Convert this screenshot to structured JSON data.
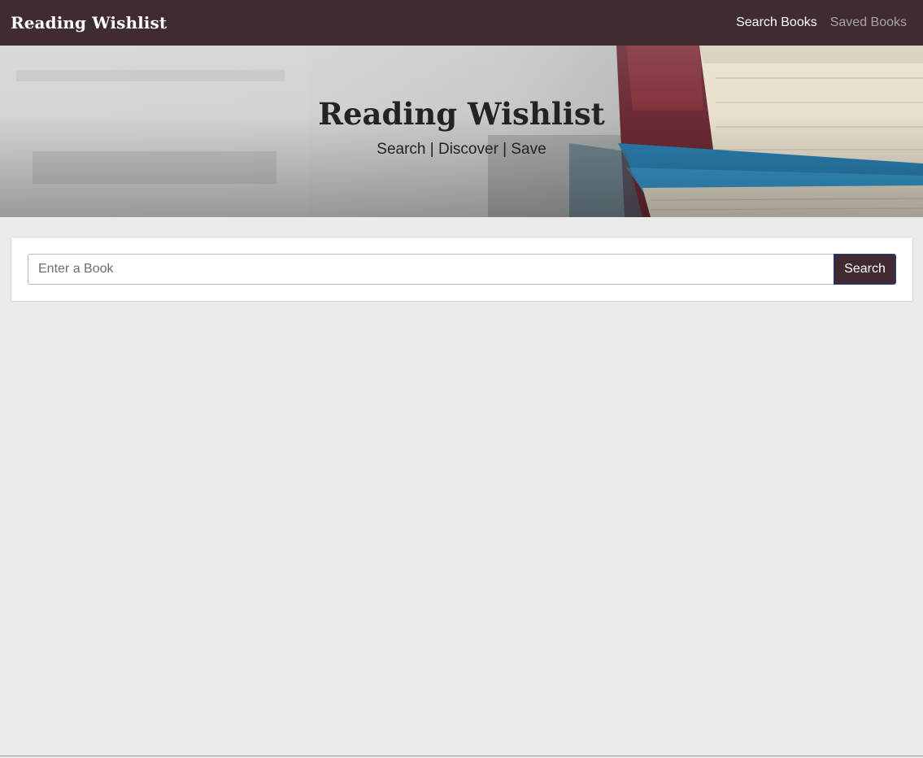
{
  "navbar": {
    "brand": "Reading Wishlist",
    "links": [
      {
        "label": "Search Books",
        "active": true
      },
      {
        "label": "Saved Books",
        "active": false
      }
    ]
  },
  "hero": {
    "title": "Reading Wishlist",
    "subtitle": "Search | Discover | Save"
  },
  "search": {
    "placeholder": "Enter a Book",
    "value": "",
    "button_label": "Search"
  },
  "colors": {
    "navbar_bg": "#402c30",
    "page_bg": "#ebebe9",
    "button_bg": "#402c30",
    "button_border": "#1d3d8f"
  }
}
